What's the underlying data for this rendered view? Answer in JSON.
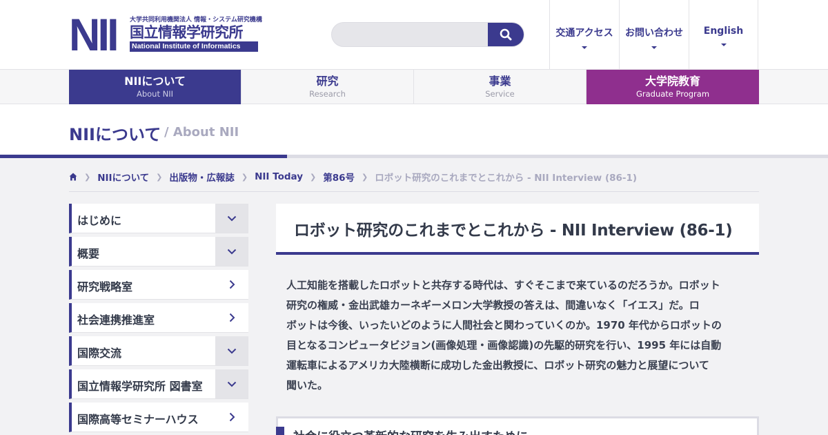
{
  "header": {
    "logo_mark": "NII",
    "logo_small": "大学共同利用機関法人 情報・システム研究機構",
    "logo_big": "国立情報学研究所",
    "logo_en": "National Institute of Informatics",
    "search": {
      "placeholder": "",
      "icon": "search-icon"
    },
    "utility_links": [
      {
        "label": "交通アクセス"
      },
      {
        "label": "お問い合わせ"
      },
      {
        "label": "English"
      }
    ]
  },
  "gnav": [
    {
      "ja": "NIIについて",
      "en": "About NII",
      "active": true
    },
    {
      "ja": "研究",
      "en": "Research"
    },
    {
      "ja": "事業",
      "en": "Service"
    },
    {
      "ja": "大学院教育",
      "en": "Graduate Program"
    }
  ],
  "section": {
    "title": "NIIについて",
    "subtitle": "/ About NII"
  },
  "breadcrumb": {
    "home_icon": "home-icon",
    "links": [
      "NIIについて",
      "出版物・広報誌",
      "NII Today",
      "第86号"
    ],
    "current": "ロボット研究のこれまでとこれから - NII Interview (86-1)"
  },
  "sidenav": [
    {
      "label": "はじめに",
      "control": "expand"
    },
    {
      "label": "概要",
      "control": "expand"
    },
    {
      "label": "研究戦略室",
      "control": "link"
    },
    {
      "label": "社会連携推進室",
      "control": "link"
    },
    {
      "label": "国際交流",
      "control": "expand"
    },
    {
      "label": "国立情報学研究所 図書室",
      "control": "expand"
    },
    {
      "label": "国際高等セミナーハウス",
      "control": "link"
    }
  ],
  "article": {
    "title": "ロボット研究のこれまでとこれから - NII Interview (86-1)",
    "lead_lines": [
      "人工知能を搭載したロボットと共存する時代は、すぐそこまで来ているのだろうか。ロボット",
      "研究の権威・金出武雄カーネギーメロン大学教授の答えは、間違いなく「イエス」だ。ロ",
      "ボットは今後、いったいどのように人間社会と関わっていくのか。1970 年代からロボットの",
      "目となるコンピュータビジョン(画像処理・画像認識)の先駆的研究を行い、1995 年には自動",
      "運転車によるアメリカ大陸横断に成功した金出教授に、ロボット研究の魅力と展望について",
      "聞いた。"
    ],
    "subheading": "社会に役立つ革新的な研究を生み出すために"
  },
  "colors": {
    "brand": "#3b3a8e",
    "graduate": "#8f2f8e"
  }
}
